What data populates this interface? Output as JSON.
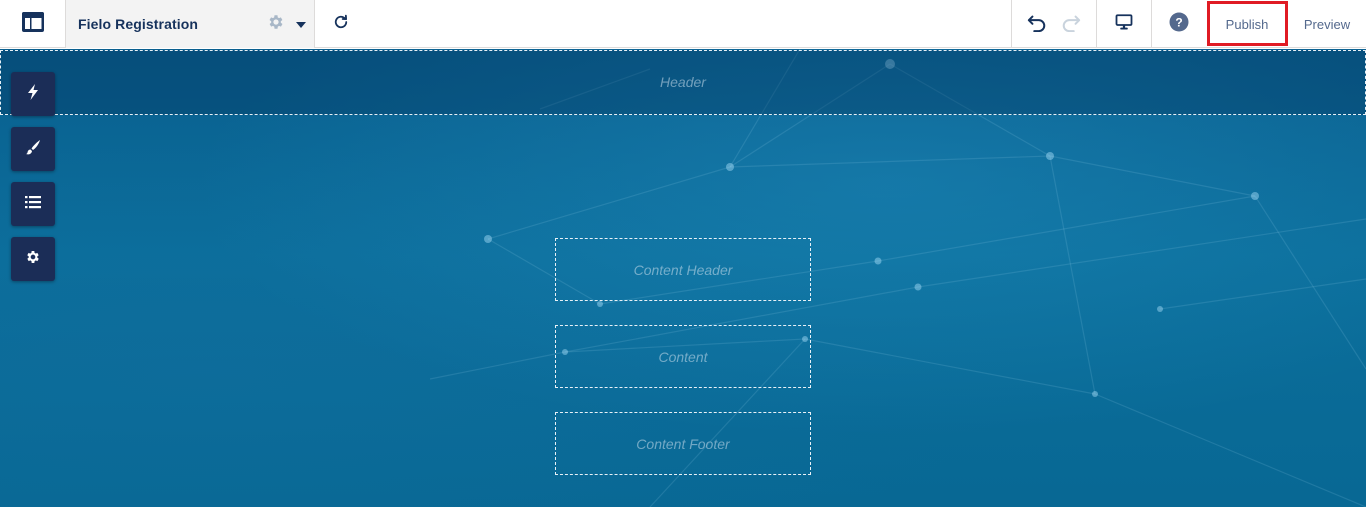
{
  "app": {
    "icon": "layout-panel-icon",
    "page_title": "Fielo Registration",
    "title_settings_icon": "gear-icon",
    "title_menu_icon": "caret-down-icon"
  },
  "toolbar": {
    "refresh_icon": "refresh-icon",
    "undo_icon": "undo-icon",
    "redo_icon": "redo-icon",
    "device_icon": "desktop-icon",
    "help_icon": "help-icon",
    "publish_label": "Publish",
    "preview_label": "Preview"
  },
  "tools": [
    {
      "icon": "lightning-icon"
    },
    {
      "icon": "brush-icon"
    },
    {
      "icon": "list-icon"
    },
    {
      "icon": "gear-icon"
    }
  ],
  "canvas": {
    "header_label": "Header",
    "content_header_label": "Content Header",
    "content_label": "Content",
    "content_footer_label": "Content Footer"
  },
  "colors": {
    "brand_navy": "#16325c",
    "tool_background": "#1b2d57",
    "canvas_blue": "#0b6e9b",
    "publish_highlight": "#e01b24"
  }
}
